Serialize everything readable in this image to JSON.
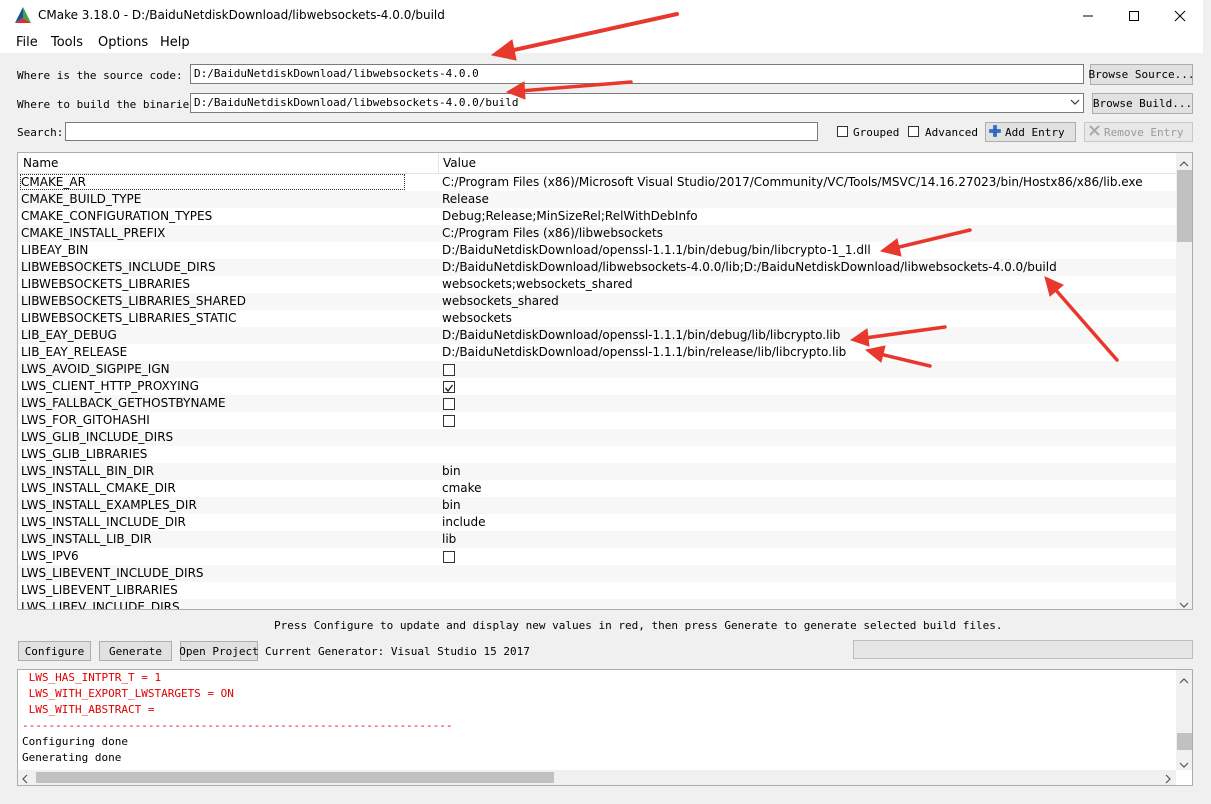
{
  "window": {
    "title": "CMake 3.18.0 - D:/BaiduNetdiskDownload/libwebsockets-4.0.0/build"
  },
  "menu": [
    "File",
    "Tools",
    "Options",
    "Help"
  ],
  "source": {
    "label": "Where is the source code:",
    "value": "D:/BaiduNetdiskDownload/libwebsockets-4.0.0",
    "button": "Browse Source..."
  },
  "build": {
    "label": "Where to build the binaries:",
    "value": "D:/BaiduNetdiskDownload/libwebsockets-4.0.0/build",
    "button": "Browse Build..."
  },
  "search": {
    "label": "Search:",
    "value": "",
    "grouped_label": "Grouped",
    "grouped_checked": false,
    "advanced_label": "Advanced",
    "advanced_checked": false,
    "add_entry": "Add Entry",
    "remove_entry": "Remove Entry"
  },
  "table": {
    "col_name": "Name",
    "col_value": "Value",
    "rows": [
      {
        "name": "CMAKE_AR",
        "value": "C:/Program Files (x86)/Microsoft Visual Studio/2017/Community/VC/Tools/MSVC/14.16.27023/bin/Hostx86/x86/lib.exe"
      },
      {
        "name": "CMAKE_BUILD_TYPE",
        "value": "Release"
      },
      {
        "name": "CMAKE_CONFIGURATION_TYPES",
        "value": "Debug;Release;MinSizeRel;RelWithDebInfo"
      },
      {
        "name": "CMAKE_INSTALL_PREFIX",
        "value": "C:/Program Files (x86)/libwebsockets"
      },
      {
        "name": "LIBEAY_BIN",
        "value": "D:/BaiduNetdiskDownload/openssl-1.1.1/bin/debug/bin/libcrypto-1_1.dll"
      },
      {
        "name": "LIBWEBSOCKETS_INCLUDE_DIRS",
        "value": "D:/BaiduNetdiskDownload/libwebsockets-4.0.0/lib;D:/BaiduNetdiskDownload/libwebsockets-4.0.0/build"
      },
      {
        "name": "LIBWEBSOCKETS_LIBRARIES",
        "value": "websockets;websockets_shared"
      },
      {
        "name": "LIBWEBSOCKETS_LIBRARIES_SHARED",
        "value": "websockets_shared"
      },
      {
        "name": "LIBWEBSOCKETS_LIBRARIES_STATIC",
        "value": "websockets"
      },
      {
        "name": "LIB_EAY_DEBUG",
        "value": "D:/BaiduNetdiskDownload/openssl-1.1.1/bin/debug/lib/libcrypto.lib"
      },
      {
        "name": "LIB_EAY_RELEASE",
        "value": "D:/BaiduNetdiskDownload/openssl-1.1.1/bin/release/lib/libcrypto.lib"
      },
      {
        "name": "LWS_AVOID_SIGPIPE_IGN",
        "checkbox": true,
        "checked": false
      },
      {
        "name": "LWS_CLIENT_HTTP_PROXYING",
        "checkbox": true,
        "checked": true
      },
      {
        "name": "LWS_FALLBACK_GETHOSTBYNAME",
        "checkbox": true,
        "checked": false
      },
      {
        "name": "LWS_FOR_GITOHASHI",
        "checkbox": true,
        "checked": false
      },
      {
        "name": "LWS_GLIB_INCLUDE_DIRS",
        "value": ""
      },
      {
        "name": "LWS_GLIB_LIBRARIES",
        "value": ""
      },
      {
        "name": "LWS_INSTALL_BIN_DIR",
        "value": "bin"
      },
      {
        "name": "LWS_INSTALL_CMAKE_DIR",
        "value": "cmake"
      },
      {
        "name": "LWS_INSTALL_EXAMPLES_DIR",
        "value": "bin"
      },
      {
        "name": "LWS_INSTALL_INCLUDE_DIR",
        "value": "include"
      },
      {
        "name": "LWS_INSTALL_LIB_DIR",
        "value": "lib"
      },
      {
        "name": "LWS_IPV6",
        "checkbox": true,
        "checked": false
      },
      {
        "name": "LWS_LIBEVENT_INCLUDE_DIRS",
        "value": ""
      },
      {
        "name": "LWS_LIBEVENT_LIBRARIES",
        "value": ""
      },
      {
        "name": "LWS_LIBEV_INCLUDE_DIRS",
        "value": ""
      }
    ]
  },
  "status_message": "Press Configure to update and display new values in red, then press Generate to generate selected build files.",
  "actions": {
    "configure": "Configure",
    "generate": "Generate",
    "open_project": "Open Project",
    "generator": "Current Generator: Visual Studio 15 2017"
  },
  "output": {
    "lines": [
      {
        "text": " LWS_HAS_INTPTR_T = 1",
        "red": true
      },
      {
        "text": " LWS_WITH_EXPORT_LWSTARGETS = ON",
        "red": true
      },
      {
        "text": " LWS_WITH_ABSTRACT =",
        "red": true
      },
      {
        "text": "-----------------------------------------------------------------",
        "red": true
      },
      {
        "text": "Configuring done",
        "red": false
      },
      {
        "text": "Generating done",
        "red": false
      }
    ]
  },
  "colors": {
    "annotation_arrow": "#e8382e",
    "error_text": "#e00000"
  }
}
